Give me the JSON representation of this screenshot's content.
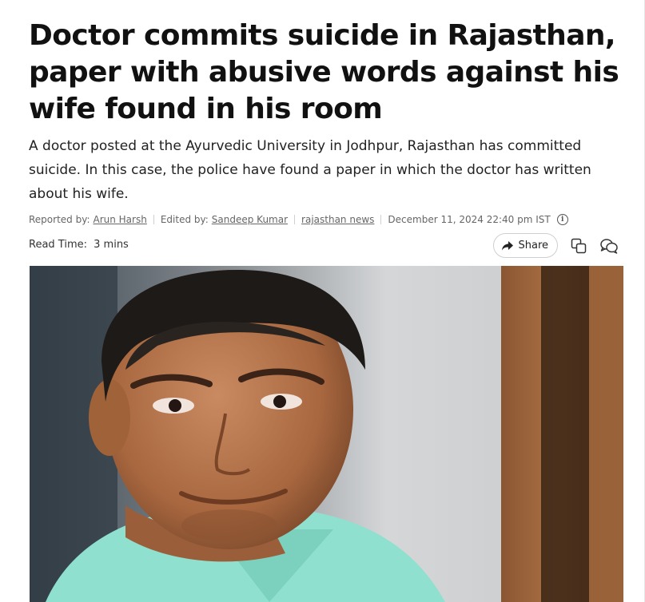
{
  "article": {
    "headline": "Doctor commits suicide in Rajasthan, paper with abusive words against his wife found in his room",
    "summary": "A doctor posted at the Ayurvedic University in Jodhpur, Rajasthan has committed suicide. In this case, the police have found a paper in which the doctor has written about his wife."
  },
  "meta": {
    "reported_label": "Reported by:",
    "reporter": "Arun Harsh",
    "edited_label": "Edited by:",
    "editor": "Sandeep Kumar",
    "section": "rajasthan news",
    "datetime": "December 11, 2024 22:40 pm IST"
  },
  "read_time": {
    "label": "Read Time:",
    "value": "3 mins"
  },
  "actions": {
    "share_label": "Share"
  },
  "icons": [
    "info-icon",
    "share-arrow-icon",
    "copy-icon",
    "comments-icon"
  ],
  "colors": {
    "text": "#111111",
    "meta_text": "#666666",
    "shirt": "#8fe0cf"
  }
}
